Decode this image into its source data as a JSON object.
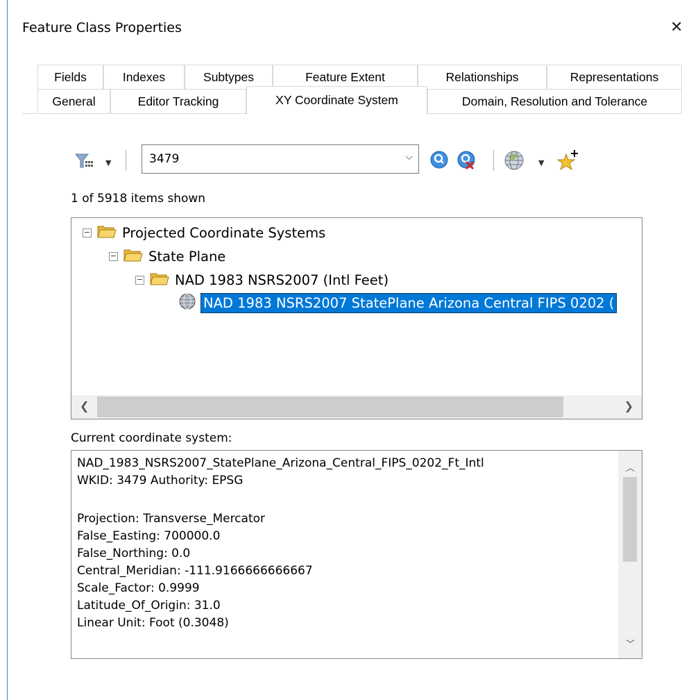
{
  "window": {
    "title": "Feature Class Properties",
    "close_glyph": "✕"
  },
  "tabs": {
    "row1": [
      "Fields",
      "Indexes",
      "Subtypes",
      "Feature Extent",
      "Relationships",
      "Representations"
    ],
    "row2": [
      "General",
      "Editor Tracking",
      "XY Coordinate System",
      "Domain, Resolution and Tolerance"
    ],
    "active": "XY Coordinate System"
  },
  "toolbar": {
    "search_value": "3479",
    "icons": [
      "filter-icon",
      "search-icon",
      "clear-search-icon",
      "globe-icon",
      "add-favorite-icon"
    ]
  },
  "status": {
    "items_shown": "1 of 5918 items shown"
  },
  "tree": {
    "nodes": [
      {
        "label": "Projected Coordinate Systems",
        "level": 0,
        "type": "folder"
      },
      {
        "label": "State Plane",
        "level": 1,
        "type": "folder"
      },
      {
        "label": "NAD 1983 NSRS2007 (Intl Feet)",
        "level": 2,
        "type": "folder"
      },
      {
        "label": "NAD 1983 NSRS2007 StatePlane Arizona Central FIPS 0202 (",
        "level": 3,
        "type": "coordinate-system",
        "selected": true
      }
    ]
  },
  "current": {
    "label": "Current coordinate system:",
    "lines": [
      "NAD_1983_NSRS2007_StatePlane_Arizona_Central_FIPS_0202_Ft_Intl",
      "WKID: 3479 Authority: EPSG",
      "",
      "Projection: Transverse_Mercator",
      "False_Easting: 700000.0",
      "False_Northing: 0.0",
      "Central_Meridian: -111.9166666666667",
      "Scale_Factor: 0.9999",
      "Latitude_Of_Origin: 31.0",
      "Linear Unit: Foot (0.3048)"
    ]
  },
  "colors": {
    "selection": "#0078d7",
    "border": "#828790",
    "folder": "#e8b93d"
  }
}
